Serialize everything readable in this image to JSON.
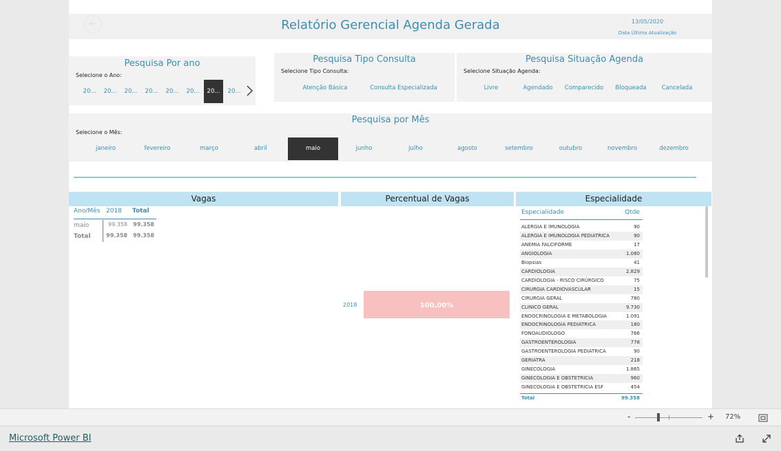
{
  "report": {
    "title": "Relatório Gerencial Agenda Gerada",
    "date_value": "13/05/2020",
    "date_label": "Data Última Atualização",
    "back_icon": "back-arrow-icon"
  },
  "filters": {
    "year": {
      "title": "Pesquisa Por ano",
      "label": "Selecione o Ano:",
      "options": [
        "20...",
        "20...",
        "20...",
        "20...",
        "20...",
        "20...",
        "20...",
        "20..."
      ],
      "selected_index": 6
    },
    "tipo": {
      "title": "Pesquisa Tipo Consulta",
      "label": "Selecione Tipo Consulta:",
      "options": [
        "Atenção Básica",
        "Consulta Especializada"
      ]
    },
    "situacao": {
      "title": "Pesquisa Situação Agenda",
      "label": "Selecione Situação Agenda:",
      "options": [
        "Livre",
        "Agendado",
        "Comparecido",
        "Bloqueada",
        "Cancelada"
      ]
    },
    "mes": {
      "title": "Pesquisa por Mês",
      "label": "Selecione o Mês:",
      "options": [
        "janeiro",
        "fevereiro",
        "março",
        "abril",
        "maio",
        "junho",
        "julho",
        "agosto",
        "setembro",
        "outubro",
        "novembro",
        "dezembro"
      ],
      "selected_index": 4
    }
  },
  "vagas": {
    "title": "Vagas",
    "headers": [
      "Ano/Mês",
      "2018",
      "Total"
    ],
    "rows": [
      [
        "maio",
        "99.358",
        "99.358"
      ],
      [
        "Total",
        "99.358",
        "99.358"
      ]
    ]
  },
  "percentual": {
    "title": "Percentual de Vagas",
    "chart_data": {
      "type": "bar",
      "categories": [
        "2018"
      ],
      "values": [
        100.0
      ],
      "value_labels": [
        "100,00%"
      ],
      "colors": [
        "#f8c0c0"
      ]
    }
  },
  "especialidade": {
    "title": "Especialidade",
    "headers": [
      "Especialidade",
      "Qtde"
    ],
    "rows": [
      [
        "ALERGIA E IMUNOLOGIA",
        "90"
      ],
      [
        "ALERGIA E IMUNOLOGIA PEDIATRICA",
        "90"
      ],
      [
        "ANEMIA FALCIFORME",
        "17"
      ],
      [
        "ANGIOLOGIA",
        "1.080"
      ],
      [
        "Biopsias",
        "41"
      ],
      [
        "CARDIOLOGIA",
        "2.829"
      ],
      [
        "CARDIOLOGIA - RISCO CIRÚRGICO",
        "75"
      ],
      [
        "CIRURGIA CARDIOVASCULAR",
        "15"
      ],
      [
        "CIRURGIA GERAL",
        "780"
      ],
      [
        "CLINICO GERAL",
        "9.730"
      ],
      [
        "ENDOCRINOLOGIA E METABOLOGIA",
        "1.091"
      ],
      [
        "ENDOCRINOLOGIA PEDIATRICA",
        "180"
      ],
      [
        "FONOAUDIOLOGO",
        "766"
      ],
      [
        "GASTROENTEROLOGIA",
        "778"
      ],
      [
        "GASTROENTEROLOGIA PEDIATRICA",
        "90"
      ],
      [
        "GERIATRA",
        "218"
      ],
      [
        "GINECOLOGIA",
        "1.865"
      ],
      [
        "GINECOLOGIA E OBSTETRICIA",
        "960"
      ],
      [
        "GINECOLOGIA E OBSTETRICIA ESF",
        "454"
      ]
    ],
    "total_label": "Total",
    "total_value": "99.358"
  },
  "footer": {
    "zoom": "72%",
    "zoom_out": "-",
    "zoom_in": "+",
    "brand_link": "Microsoft Power BI"
  },
  "colors": {
    "accent": "#3a8fb0",
    "header_band": "#bfe3f2",
    "selected_chip": "#333333",
    "bar": "#f8c0c0",
    "teal_line": "#7fd1c7"
  }
}
